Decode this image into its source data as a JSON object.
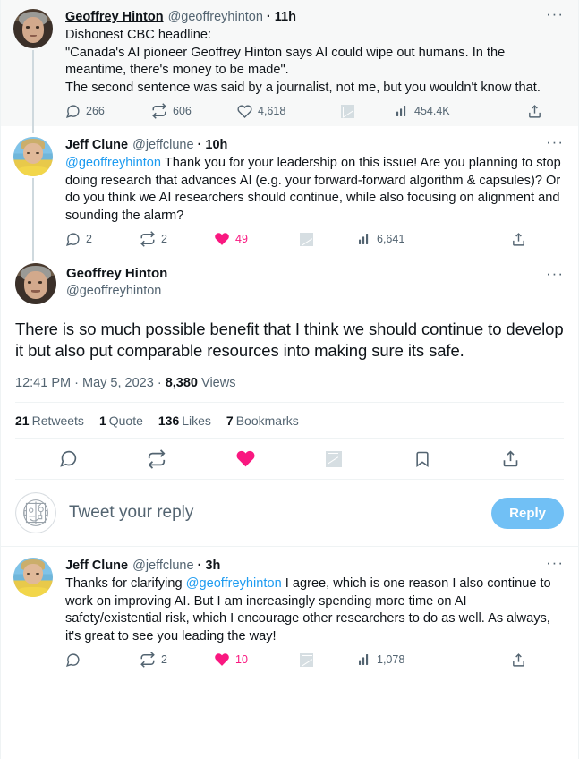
{
  "thread": {
    "tweets": [
      {
        "id": "tweet-hinton-root",
        "author_name": "Geoffrey Hinton",
        "author_handle": "@geoffreyhinton",
        "timestamp": "11h",
        "separator": "·",
        "text_lines": [
          "Dishonest CBC headline:",
          "\"Canada's AI pioneer Geoffrey Hinton says AI could wipe out humans. In the meantime, there's money to be made\".",
          "The second sentence was said by a journalist, not me, but you wouldn't know that."
        ],
        "actions": {
          "reply_count": "266",
          "retweet_count": "606",
          "like_count": "4,618",
          "view_count": "454.4K"
        },
        "more_label": "···"
      },
      {
        "id": "tweet-clune-question",
        "author_name": "Jeff Clune",
        "author_handle": "@jeffclune",
        "timestamp": "10h",
        "separator": "·",
        "mention": "@geoffreyhinton",
        "text": " Thank you for your leadership on this issue! Are you planning to stop doing research that advances AI (e.g. your forward-forward algorithm & capsules)? Or do you think we AI researchers should continue, while also focusing on alignment and sounding the alarm?",
        "actions": {
          "reply_count": "2",
          "retweet_count": "2",
          "like_count": "49",
          "view_count": "6,641"
        },
        "more_label": "···"
      }
    ]
  },
  "main_tweet": {
    "author_name": "Geoffrey Hinton",
    "author_handle": "@geoffreyhinton",
    "more_label": "···",
    "text": "There is so much possible benefit that I think we should continue to develop it but also put comparable resources into making sure its safe.",
    "time": "12:41 PM",
    "date": "May 5, 2023",
    "views_count": "8,380",
    "views_label": "Views",
    "sep": "·",
    "stats": [
      {
        "count": "21",
        "label": "Retweets"
      },
      {
        "count": "1",
        "label": "Quote"
      },
      {
        "count": "136",
        "label": "Likes"
      },
      {
        "count": "7",
        "label": "Bookmarks"
      }
    ],
    "action_icons": [
      "reply-icon",
      "retweet-icon",
      "like-icon",
      "broken-image-icon",
      "bookmark-icon",
      "share-icon"
    ]
  },
  "composer": {
    "avatar_name": "robot-avatar",
    "placeholder": "Tweet your reply",
    "reply_button": "Reply"
  },
  "reply_tweet": {
    "author_name": "Jeff Clune",
    "author_handle": "@jeffclune",
    "timestamp": "3h",
    "separator": "·",
    "text_before": "Thanks for clarifying ",
    "mention": "@geoffreyhinton",
    "text_after": " I agree, which is one reason I also continue to work on improving AI. But I am increasingly spending more time on AI safety/existential risk, which I encourage other researchers to do as well. As always, it's great to see you leading the way!",
    "actions": {
      "reply_count": "",
      "retweet_count": "2",
      "like_count": "10",
      "view_count": "1,078"
    },
    "more_label": "···"
  },
  "colors": {
    "accent_blue": "#1d9bf0",
    "reply_button_blue": "#71c0f5",
    "like_pink": "#f91880",
    "muted_gray": "#536471",
    "text_dark": "#0f1419",
    "highlight_bg": "#f7f8f8",
    "divider": "#eff3f4"
  }
}
